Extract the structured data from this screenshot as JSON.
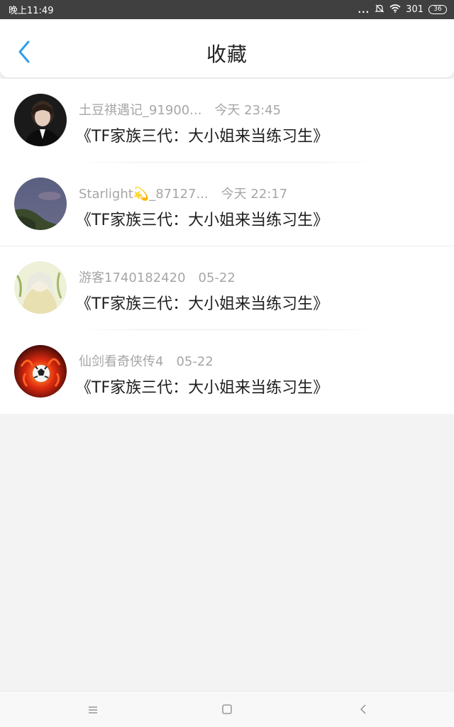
{
  "status_bar": {
    "time": "晚上11:49",
    "dots": "...",
    "signal": "301",
    "battery": "36"
  },
  "header": {
    "title": "收藏",
    "accent_color": "#2f9ee8"
  },
  "favorites": [
    {
      "user": "土豆祺遇记_91900...",
      "time": "今天 23:45",
      "title": "《TF家族三代：大小姐来当练习生》"
    },
    {
      "user": "Starlight💫_87127...",
      "time": "今天 22:17",
      "title": "《TF家族三代：大小姐来当练习生》"
    },
    {
      "user": "游客1740182420",
      "time": "05-22",
      "title": "《TF家族三代：大小姐来当练习生》"
    },
    {
      "user": "仙剑看奇侠传4",
      "time": "05-22",
      "title": "《TF家族三代：大小姐来当练习生》"
    }
  ],
  "icons": {
    "back": "chevron-left-icon",
    "menu": "menu-icon",
    "home": "home-square-icon",
    "nav_back": "nav-back-icon"
  }
}
